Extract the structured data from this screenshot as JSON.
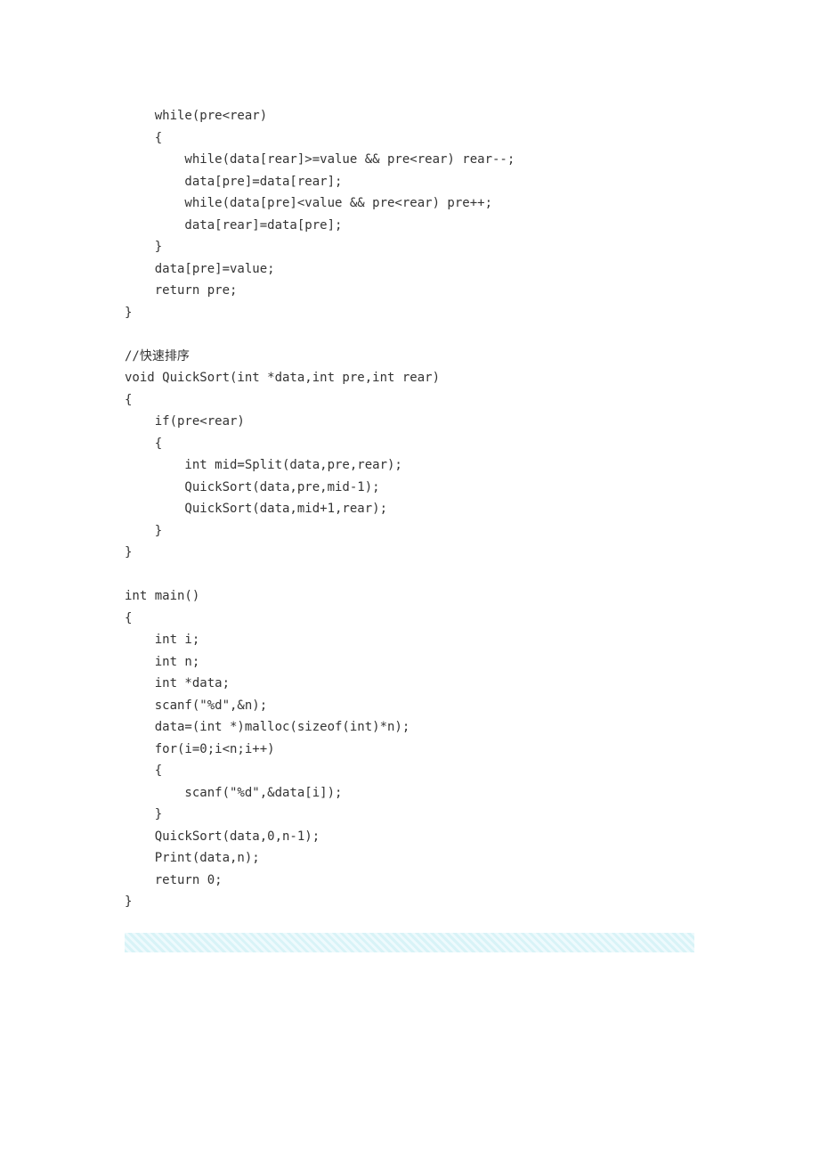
{
  "code": {
    "lines": [
      "    while(pre<rear)",
      "    {",
      "        while(data[rear]>=value && pre<rear) rear--;",
      "        data[pre]=data[rear];",
      "        while(data[pre]<value && pre<rear) pre++;",
      "        data[rear]=data[pre];",
      "    }",
      "    data[pre]=value;",
      "    return pre;",
      "}",
      "",
      "//快速排序",
      "void QuickSort(int *data,int pre,int rear)",
      "{",
      "    if(pre<rear)",
      "    {",
      "        int mid=Split(data,pre,rear);",
      "        QuickSort(data,pre,mid-1);",
      "        QuickSort(data,mid+1,rear);",
      "    }",
      "}",
      "",
      "int main()",
      "{",
      "    int i;",
      "    int n;",
      "    int *data;",
      "    scanf(\"%d\",&n);",
      "    data=(int *)malloc(sizeof(int)*n);",
      "    for(i=0;i<n;i++)",
      "    {",
      "        scanf(\"%d\",&data[i]);",
      "    }",
      "    QuickSort(data,0,n-1);",
      "    Print(data,n);",
      "    return 0;",
      "}"
    ]
  }
}
